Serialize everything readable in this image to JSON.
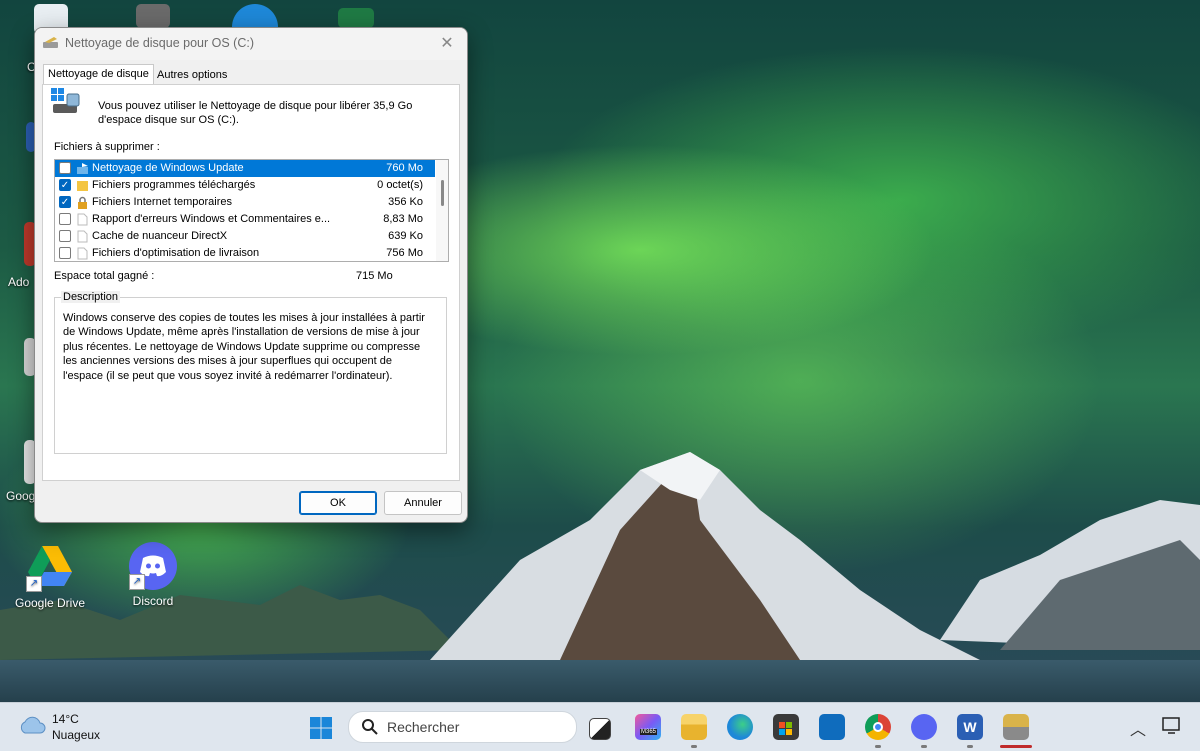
{
  "desktop": {
    "icons": [
      {
        "label": "Google Drive"
      },
      {
        "label": "Discord"
      }
    ],
    "partial_labels": [
      "C",
      "Ado",
      "Goog"
    ]
  },
  "dialog": {
    "title": "Nettoyage de disque pour OS (C:)",
    "tabs": [
      {
        "label": "Nettoyage de disque",
        "active": true
      },
      {
        "label": "Autres options",
        "active": false
      }
    ],
    "intro": "Vous pouvez utiliser le Nettoyage de disque pour libérer 35,9 Go d'espace disque sur OS (C:).",
    "files_label": "Fichiers à supprimer :",
    "files": [
      {
        "name": "Nettoyage de Windows Update",
        "size": "760 Mo",
        "checked": false,
        "selected": true,
        "icon": "windows-update-icon"
      },
      {
        "name": "Fichiers programmes téléchargés",
        "size": "0 octet(s)",
        "checked": true,
        "selected": false,
        "icon": "folder-icon"
      },
      {
        "name": "Fichiers Internet temporaires",
        "size": "356 Ko",
        "checked": true,
        "selected": false,
        "icon": "lock-icon"
      },
      {
        "name": "Rapport d'erreurs Windows et Commentaires e...",
        "size": "8,83 Mo",
        "checked": false,
        "selected": false,
        "icon": "file-icon"
      },
      {
        "name": "Cache de nuanceur DirectX",
        "size": "639 Ko",
        "checked": false,
        "selected": false,
        "icon": "file-icon"
      },
      {
        "name": "Fichiers d'optimisation de livraison",
        "size": "756 Mo",
        "checked": false,
        "selected": false,
        "icon": "file-icon"
      }
    ],
    "total_label": "Espace total gagné :",
    "total_value": "715 Mo",
    "description_label": "Description",
    "description": "Windows conserve des copies de toutes les mises à jour installées à partir de Windows Update, même après l'installation de versions de mise à jour plus récentes. Le nettoyage de Windows Update supprime ou compresse les anciennes versions des mises à jour superflues qui occupent de l'espace (il se peut que vous soyez invité à redémarrer l'ordinateur).",
    "ok_label": "OK",
    "cancel_label": "Annuler"
  },
  "taskbar": {
    "weather_temp": "14°C",
    "weather_desc": "Nuageux",
    "search_placeholder": "Rechercher",
    "apps": [
      "task-view-icon",
      "microsoft-365-icon",
      "file-explorer-icon",
      "edge-icon",
      "store-icon",
      "outlook-icon",
      "chrome-icon",
      "discord-icon",
      "word-icon",
      "disk-cleanup-icon"
    ],
    "m365_badge": "M365"
  },
  "colors": {
    "accent": "#0067c0",
    "selection": "#0078d7",
    "taskbar": "#dfe6ee"
  }
}
